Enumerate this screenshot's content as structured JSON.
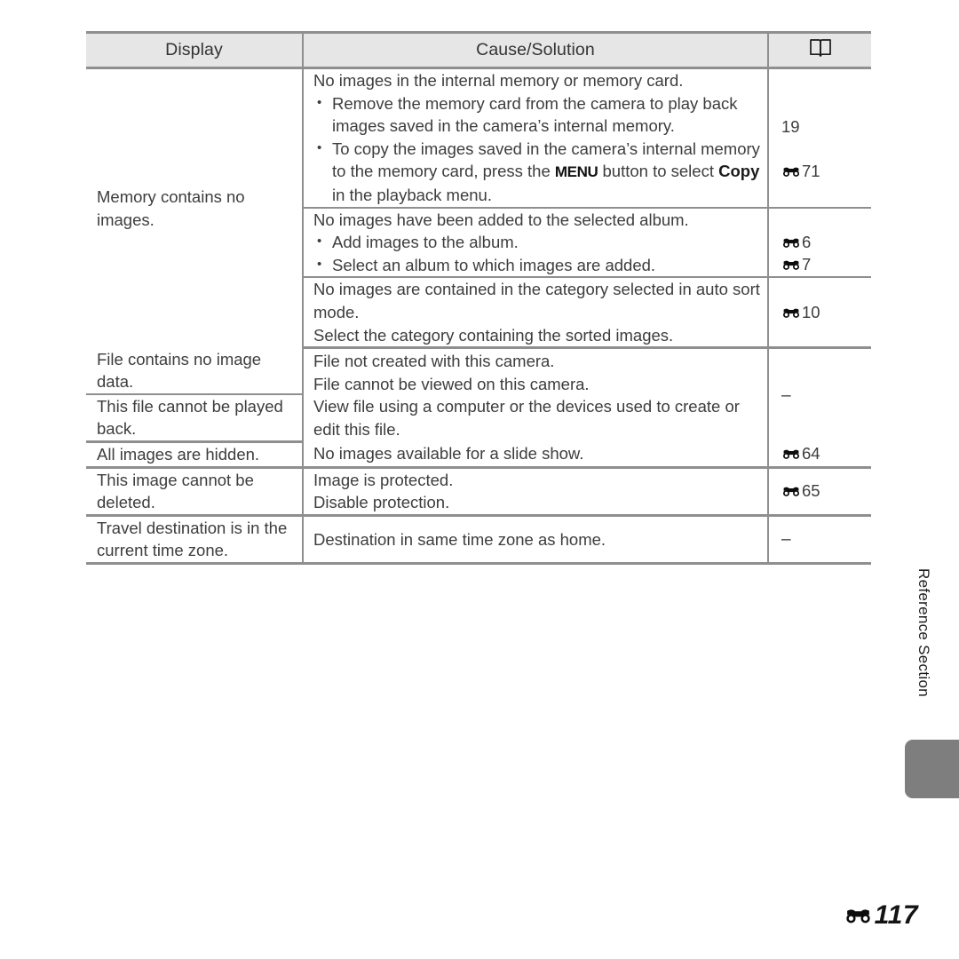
{
  "document": {
    "page_number": "117",
    "page_number_prefix_icon": "binoculars-e-icon",
    "side_tab_label": "Reference Section"
  },
  "table": {
    "headers": {
      "display": "Display",
      "cause_solution": "Cause/Solution",
      "reference": "open-book-icon"
    },
    "rows": [
      {
        "display": "Memory contains no images.",
        "subrows": [
          {
            "lead": "No images in the internal memory or memory card.",
            "bullets": [
              "Remove the memory card from the camera to play back images saved in the camera’s internal memory.",
              "To copy the images saved in the camera’s internal memory to the memory card, press the MENU button to select Copy in the playback menu."
            ],
            "refs": [
              {
                "icon": "none",
                "text": "19"
              },
              {
                "icon": "binoculars-e-icon",
                "text": "71"
              }
            ]
          },
          {
            "lead": "No images have been added to the selected album.",
            "bullets": [
              "Add images to the album.",
              "Select an album to which images are added."
            ],
            "refs": [
              {
                "icon": "binoculars-e-icon",
                "text": "6"
              },
              {
                "icon": "binoculars-e-icon",
                "text": "7"
              }
            ]
          },
          {
            "lead": "No images are contained in the category selected in auto sort mode.",
            "lines": [
              "Select the category containing the sorted images."
            ],
            "refs": [
              {
                "icon": "binoculars-e-icon",
                "text": "10"
              }
            ]
          }
        ]
      },
      {
        "display": "File contains no image data.",
        "display2": "This file cannot be played back.",
        "cause_lines": [
          "File not created with this camera.",
          "File cannot be viewed on this camera."
        ],
        "cause_lines2": [
          "View file using a computer or the devices used to create or edit this file."
        ],
        "refs": [
          {
            "icon": "none",
            "text": "–"
          }
        ]
      },
      {
        "display": "All images are hidden.",
        "cause": "No images available for a slide show.",
        "refs": [
          {
            "icon": "binoculars-e-icon",
            "text": "64"
          }
        ]
      },
      {
        "display": "This image cannot be deleted.",
        "cause_lines": [
          "Image is protected.",
          "Disable protection."
        ],
        "refs": [
          {
            "icon": "binoculars-e-icon",
            "text": "65"
          }
        ]
      },
      {
        "display": "Travel destination is in the current time zone.",
        "cause": "Destination in same time zone as home.",
        "refs": [
          {
            "icon": "none",
            "text": "–"
          }
        ]
      }
    ]
  },
  "inline_terms": {
    "menu_button": "MENU",
    "copy_term": "Copy"
  },
  "colors": {
    "header_fill": "#e6e6e6",
    "rule": "#8f8f8f",
    "text": "#3d3d3d",
    "tab": "#7e7e7e"
  }
}
